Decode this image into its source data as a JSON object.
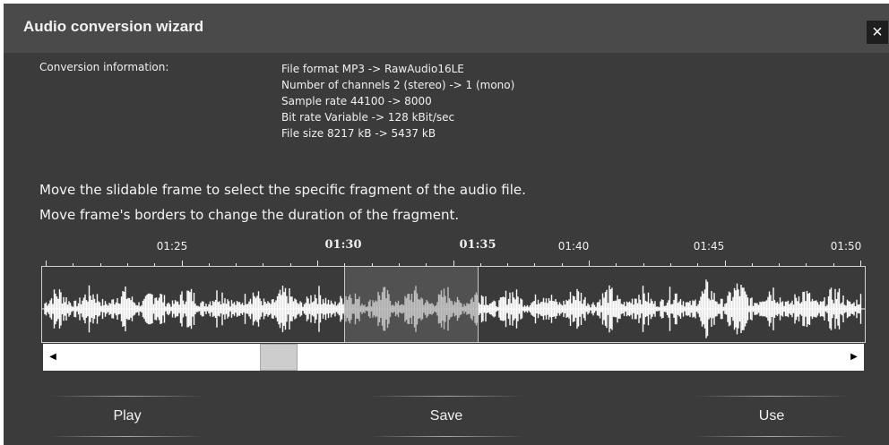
{
  "dialog": {
    "title": "Audio conversion wizard",
    "close_glyph": "×",
    "close_icon": "close-icon"
  },
  "info": {
    "label": "Conversion information:",
    "lines": [
      "File format MP3 -> RawAudio16LE",
      "Number of channels 2 (stereo) -> 1 (mono)",
      "Sample rate 44100 -> 8000",
      "Bit rate Variable -> 128 kBit/sec",
      "File size 8217 kB -> 5437 kB"
    ]
  },
  "instructions": [
    "Move the slidable frame to select the specific fragment of the audio file.",
    "Move frame's borders to change the duration of the fragment."
  ],
  "timeline": {
    "labels": [
      "01:25",
      "01:30",
      "01:35",
      "01:40",
      "01:45",
      "01:50"
    ],
    "bold_labels": [
      "01:30",
      "01:35"
    ]
  },
  "selection": {
    "start": "01:30",
    "end": "01:35"
  },
  "scrollbar": {
    "left_icon": "scroll-left-arrow-icon",
    "right_icon": "scroll-right-arrow-icon",
    "left_glyph": "◀",
    "right_glyph": "▶",
    "position": 0.27
  },
  "buttons": {
    "play": "Play",
    "save": "Save",
    "use": "Use"
  }
}
